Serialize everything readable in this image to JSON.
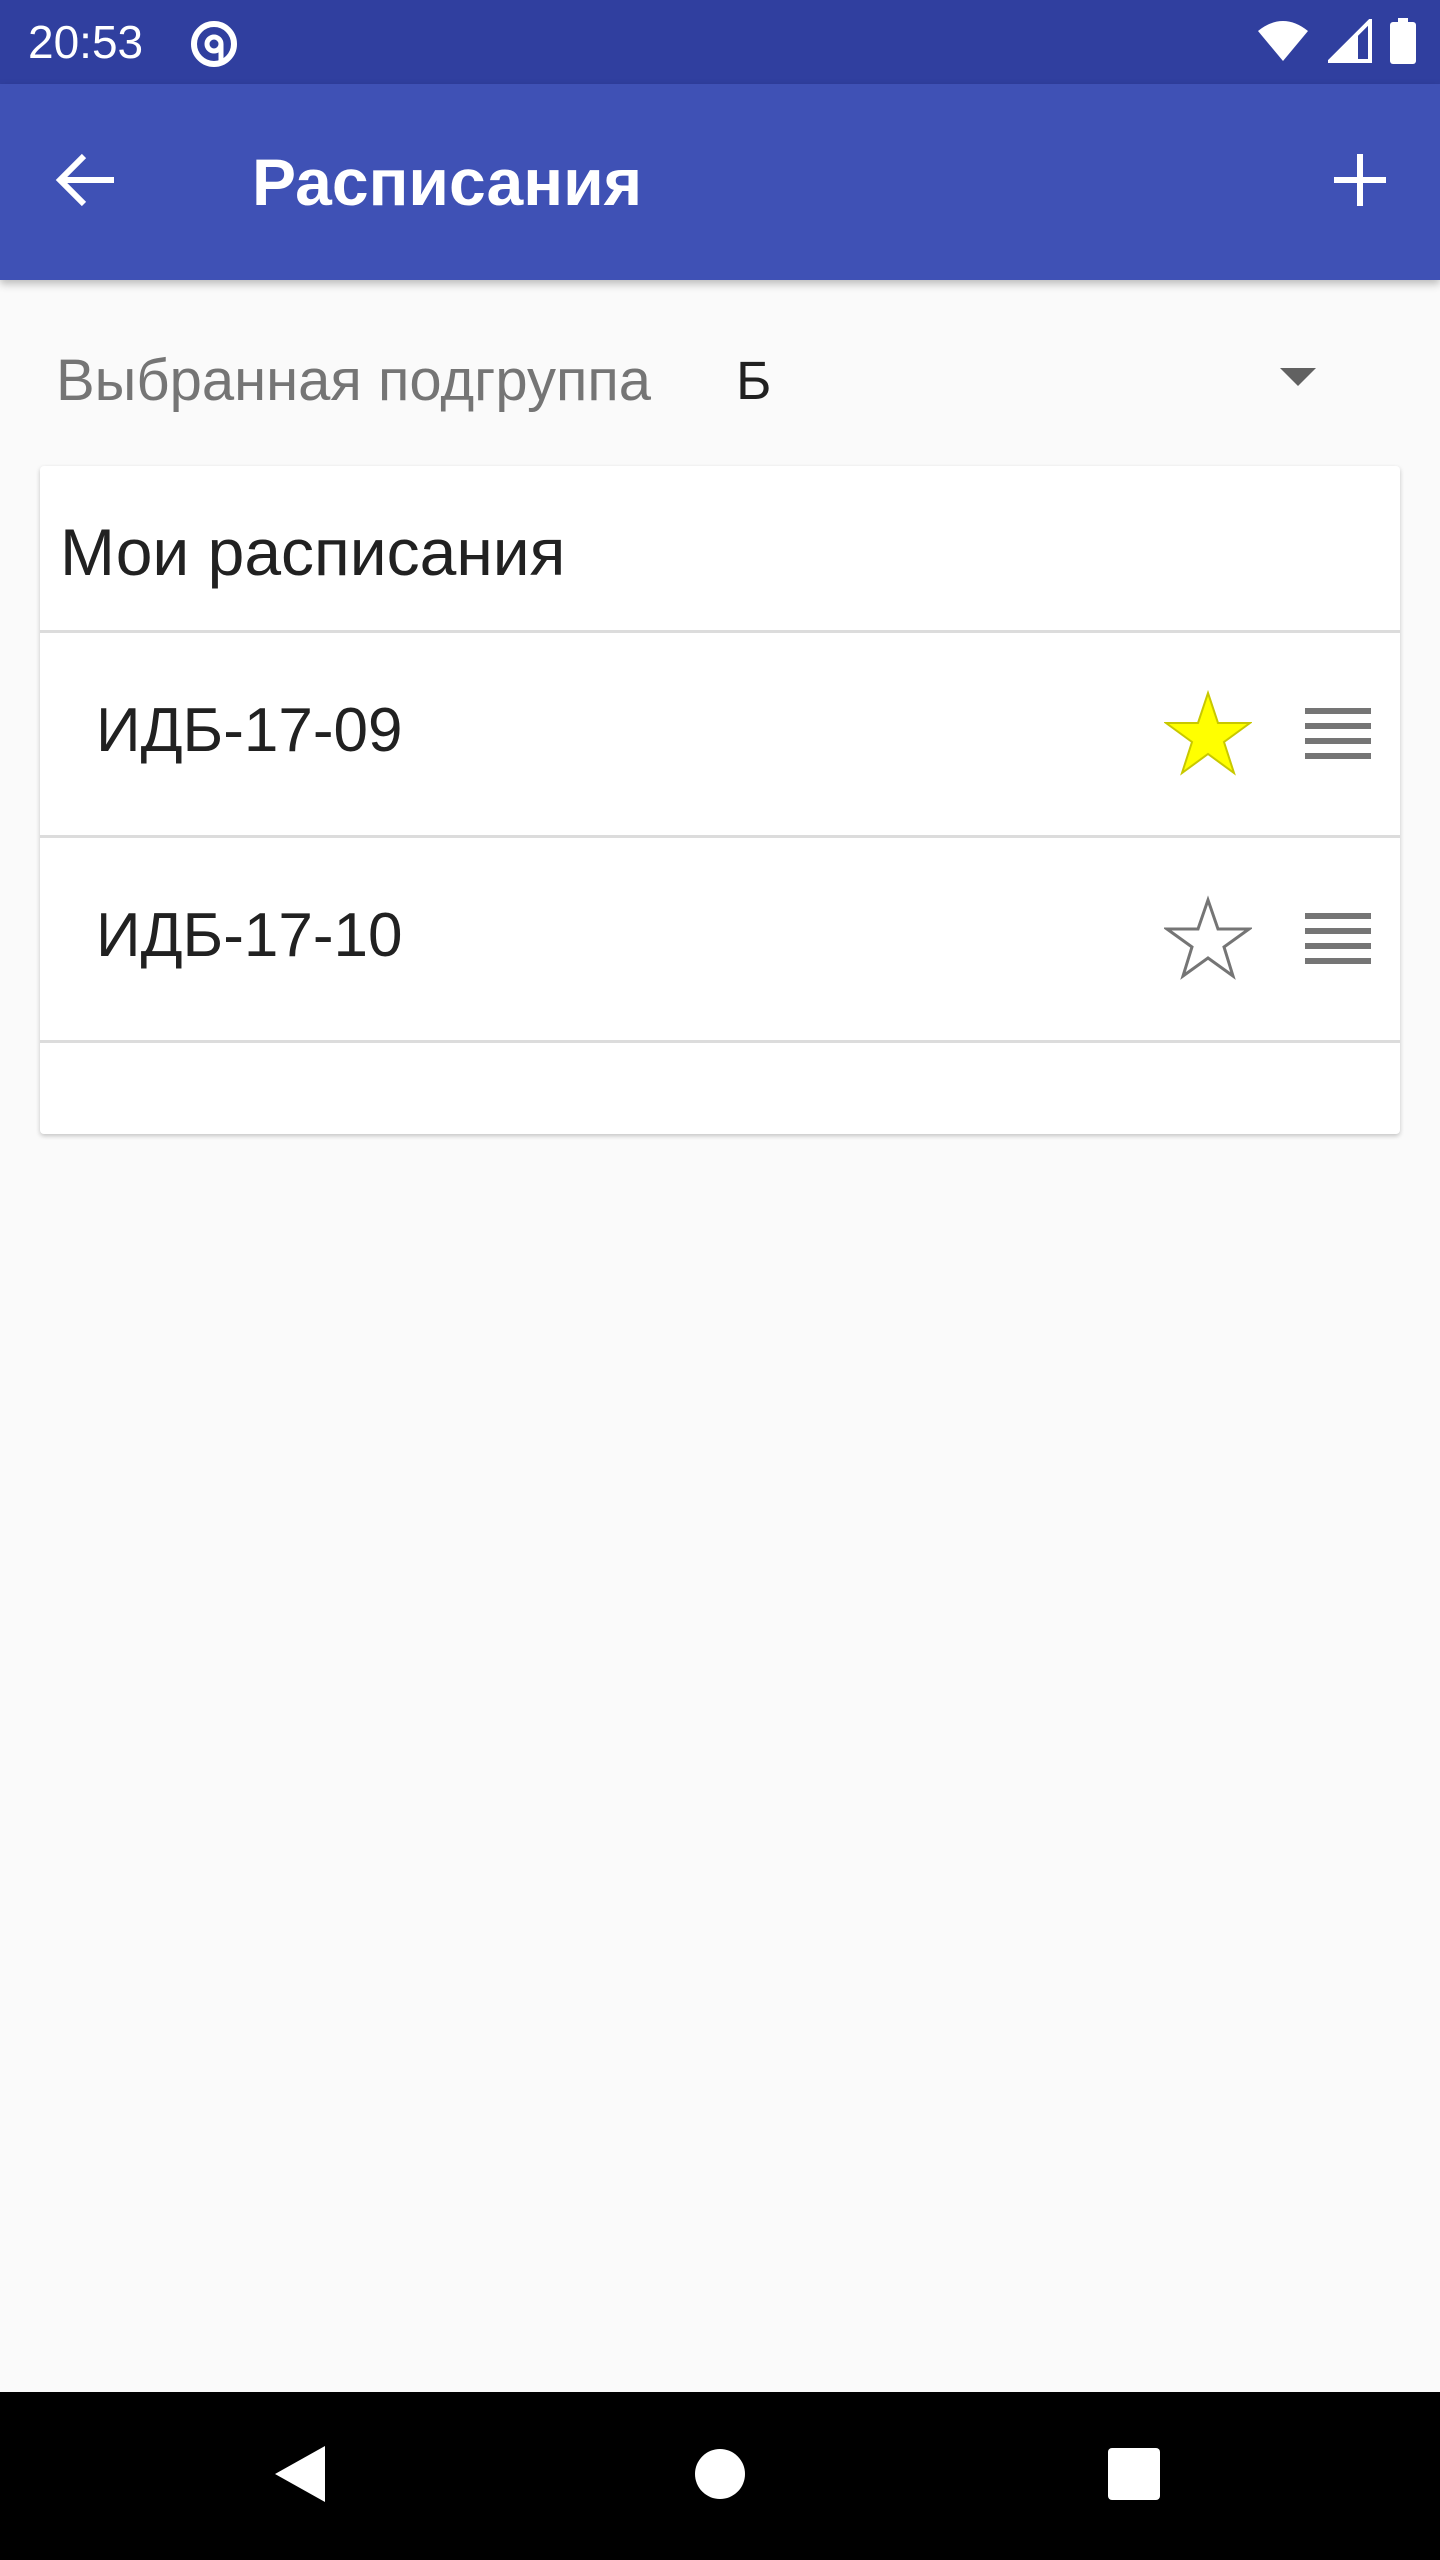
{
  "status_bar": {
    "time": "20:53",
    "app_icon": "at-sign-icon",
    "icons": [
      "wifi-icon",
      "signal-icon",
      "battery-icon"
    ]
  },
  "app_bar": {
    "title": "Расписания",
    "back_icon": "arrow-back-icon",
    "add_icon": "plus-icon",
    "background_color": "#3f51b5",
    "status_color": "#303f9f"
  },
  "subgroup": {
    "label": "Выбранная подгруппа",
    "selected_value": "Б",
    "dropdown_icon": "arrow-drop-down-icon"
  },
  "my_schedules": {
    "title": "Мои расписания",
    "items": [
      {
        "label": "ИДБ-17-09",
        "favorite": true,
        "star_icon": "star-filled-icon",
        "handle_icon": "drag-handle-icon"
      },
      {
        "label": "ИДБ-17-10",
        "favorite": false,
        "star_icon": "star-outline-icon",
        "handle_icon": "drag-handle-icon"
      }
    ],
    "favorite_color": "#ffff00"
  },
  "nav_bar": {
    "buttons": [
      "back-triangle-icon",
      "home-circle-icon",
      "recents-square-icon"
    ]
  }
}
